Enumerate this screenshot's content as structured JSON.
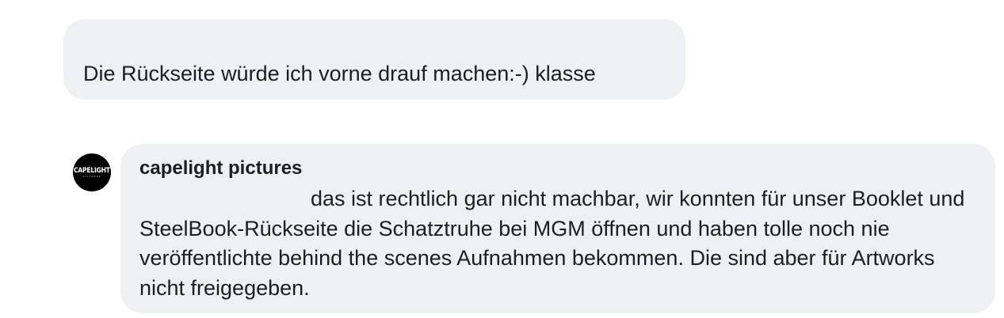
{
  "comment": {
    "text": "Die Rückseite würde ich vorne drauf machen:-) klasse"
  },
  "reply": {
    "avatar_label": "CAPELIGHT",
    "avatar_sublabel": "PICTURES",
    "author": "capelight pictures",
    "text": "das ist rechtlich gar nicht machbar, wir konnten für unser Booklet und SteelBook-Rückseite die Schatztruhe bei MGM öffnen und haben tolle noch nie veröffentlichte behind the scenes Aufnahmen bekommen. Die sind aber für Artworks nicht freigegeben."
  },
  "colors": {
    "bubble_background": "#eff0f3",
    "text": "#1c1e21",
    "avatar_background": "#000000"
  }
}
